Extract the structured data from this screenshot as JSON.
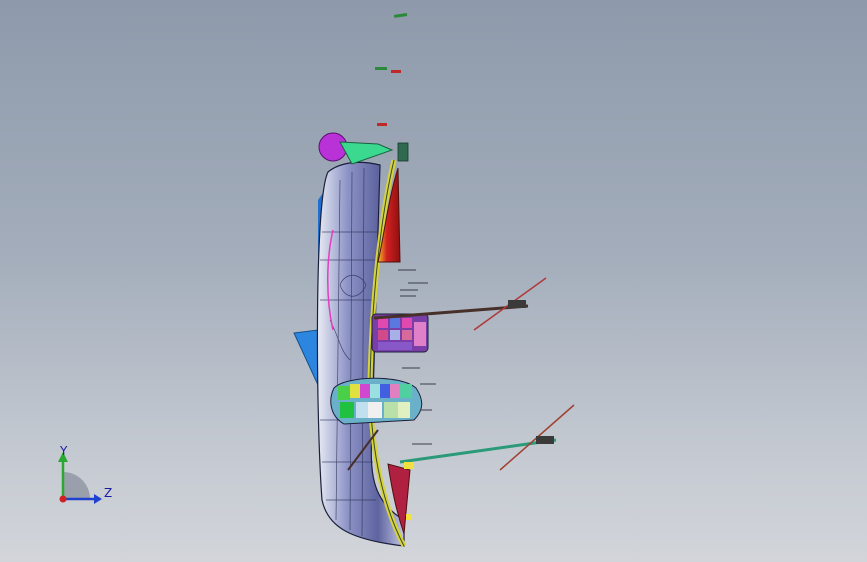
{
  "viewport": {
    "model": "ship-hull-3d-model",
    "background": [
      "#8e9aab",
      "#d2d5da"
    ]
  },
  "triad": {
    "y_label": "Y",
    "z_label": "Z",
    "colors": {
      "y": "#2aa832",
      "z": "#2040d0",
      "x": "#d02020"
    }
  }
}
